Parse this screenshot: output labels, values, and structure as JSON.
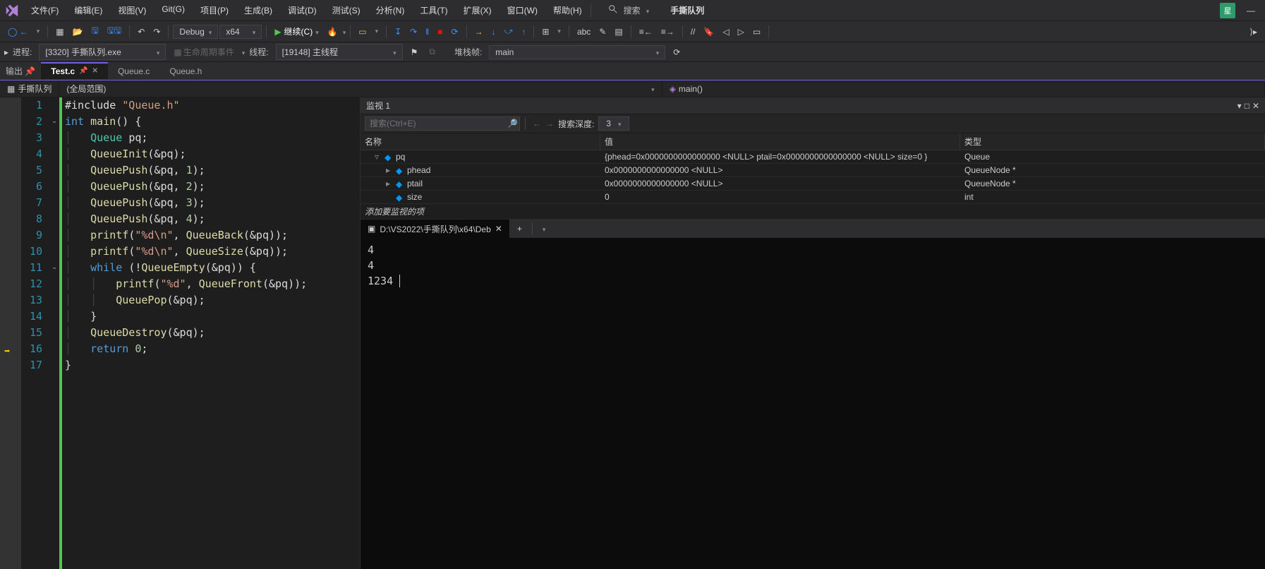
{
  "menu": [
    "文件(F)",
    "编辑(E)",
    "视图(V)",
    "Git(G)",
    "项目(P)",
    "生成(B)",
    "调试(D)",
    "测试(S)",
    "分析(N)",
    "工具(T)",
    "扩展(X)",
    "窗口(W)",
    "帮助(H)"
  ],
  "search_label": "搜索",
  "project_name": "手撕队列",
  "avatar_initial": "星",
  "toolbar": {
    "config": "Debug",
    "platform": "x64",
    "continue_label": "继续(C)"
  },
  "debugbar": {
    "process_label": "进程:",
    "process_value": "[3320] 手撕队列.exe",
    "lifecycle_label": "生命周期事件",
    "thread_label": "线程:",
    "thread_value": "[19148] 主线程",
    "stack_label": "堆栈帧:",
    "stack_value": "main"
  },
  "side_tool_output": "输出",
  "tabs": [
    {
      "label": "Test.c",
      "active": true,
      "pinned": true,
      "close": true
    },
    {
      "label": "Queue.c",
      "active": false
    },
    {
      "label": "Queue.h",
      "active": false
    }
  ],
  "context": {
    "project": "手撕队列",
    "scope": "(全局范围)",
    "func": "main()"
  },
  "code": {
    "lines": [
      {
        "n": 1,
        "html": "<span class='c-punc'>#include </span><span class='c-str'>\"Queue.h\"</span>"
      },
      {
        "n": 2,
        "fold": "-",
        "html": "<span class='c-kw'>int</span> <span class='c-func'>main</span><span class='c-punc'>() {</span>"
      },
      {
        "n": 3,
        "html": "<span class='guide'>│   </span><span class='c-type'>Queue</span> <span class='c-id'>pq</span><span class='c-punc'>;</span>"
      },
      {
        "n": 4,
        "html": "<span class='guide'>│   </span><span class='c-func'>QueueInit</span><span class='c-punc'>(&amp;pq);</span>"
      },
      {
        "n": 5,
        "html": "<span class='guide'>│   </span><span class='c-func'>QueuePush</span><span class='c-punc'>(&amp;pq, </span><span class='c-num'>1</span><span class='c-punc'>);</span>"
      },
      {
        "n": 6,
        "html": "<span class='guide'>│   </span><span class='c-func'>QueuePush</span><span class='c-punc'>(&amp;pq, </span><span class='c-num'>2</span><span class='c-punc'>);</span>"
      },
      {
        "n": 7,
        "html": "<span class='guide'>│   </span><span class='c-func'>QueuePush</span><span class='c-punc'>(&amp;pq, </span><span class='c-num'>3</span><span class='c-punc'>);</span>"
      },
      {
        "n": 8,
        "html": "<span class='guide'>│   </span><span class='c-func'>QueuePush</span><span class='c-punc'>(&amp;pq, </span><span class='c-num'>4</span><span class='c-punc'>);</span>"
      },
      {
        "n": 9,
        "html": "<span class='guide'>│   </span><span class='c-func'>printf</span><span class='c-punc'>(</span><span class='c-str'>\"%d\\n\"</span><span class='c-punc'>, </span><span class='c-func'>QueueBack</span><span class='c-punc'>(&amp;pq));</span>"
      },
      {
        "n": 10,
        "html": "<span class='guide'>│   </span><span class='c-func'>printf</span><span class='c-punc'>(</span><span class='c-str'>\"%d\\n\"</span><span class='c-punc'>, </span><span class='c-func'>QueueSize</span><span class='c-punc'>(&amp;pq));</span>"
      },
      {
        "n": 11,
        "fold": "-",
        "html": "<span class='guide'>│   </span><span class='c-kw'>while</span> <span class='c-punc'>(!</span><span class='c-func'>QueueEmpty</span><span class='c-punc'>(&amp;pq)) {</span>"
      },
      {
        "n": 12,
        "html": "<span class='guide'>│   </span><span class='guide'>│   </span><span class='c-func'>printf</span><span class='c-punc'>(</span><span class='c-str'>\"%d\"</span><span class='c-punc'>, </span><span class='c-func'>QueueFront</span><span class='c-punc'>(&amp;pq));</span>"
      },
      {
        "n": 13,
        "html": "<span class='guide'>│   </span><span class='guide'>│   </span><span class='c-func'>QueuePop</span><span class='c-punc'>(&amp;pq);</span>"
      },
      {
        "n": 14,
        "html": "<span class='guide'>│   </span><span class='c-punc'>}</span>"
      },
      {
        "n": 15,
        "html": "<span class='guide'>│   </span><span class='c-func'>QueueDestroy</span><span class='c-punc'>(&amp;pq);</span>"
      },
      {
        "n": 16,
        "bp": true,
        "html": "<span class='guide'>│   </span><span class='c-kw'>return</span> <span class='c-num'>0</span><span class='c-punc'>;</span>"
      },
      {
        "n": 17,
        "html": "<span class='c-punc'>}</span>"
      }
    ]
  },
  "watch": {
    "title": "监视 1",
    "search_placeholder": "搜索(Ctrl+E)",
    "depth_label": "搜索深度:",
    "depth_value": "3",
    "headers": {
      "name": "名称",
      "value": "值",
      "type": "类型"
    },
    "rows": [
      {
        "indent": 1,
        "exp": "▿",
        "name": "pq",
        "value": "{phead=0x0000000000000000 <NULL> ptail=0x0000000000000000 <NULL> size=0 }",
        "type": "Queue"
      },
      {
        "indent": 2,
        "exp": "▸",
        "name": "phead",
        "value": "0x0000000000000000 <NULL>",
        "type": "QueueNode *"
      },
      {
        "indent": 2,
        "exp": "▸",
        "name": "ptail",
        "value": "0x0000000000000000 <NULL>",
        "type": "QueueNode *"
      },
      {
        "indent": 2,
        "exp": "",
        "name": "size",
        "value": "0",
        "type": "int"
      }
    ],
    "add_item": "添加要监视的项"
  },
  "terminal": {
    "tab": "D:\\VS2022\\手撕队列\\x64\\Deb",
    "lines": [
      "4",
      "4",
      "1234"
    ]
  }
}
